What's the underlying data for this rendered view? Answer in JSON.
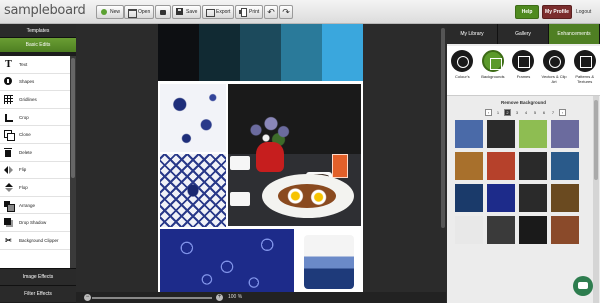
{
  "header": {
    "logo_text": "sampleboard",
    "buttons": [
      {
        "label": "New",
        "icon": "new-icon"
      },
      {
        "label": "Open",
        "icon": "open-icon"
      },
      {
        "label": "",
        "icon": "bag-icon"
      },
      {
        "label": "Save",
        "icon": "save-icon"
      },
      {
        "label": "Export",
        "icon": "export-icon"
      },
      {
        "label": "Print",
        "icon": "print-icon"
      }
    ],
    "undo_glyph": "↶",
    "redo_glyph": "↷",
    "help_label": "Help",
    "profile_label": "My Profile",
    "logout_label": "Logout"
  },
  "sidebar": {
    "templates_label": "Templates",
    "basic_edits_label": "Basic Edits",
    "tools": [
      {
        "label": "Text",
        "icon": "text-icon"
      },
      {
        "label": "Shapes",
        "icon": "shapes-icon"
      },
      {
        "label": "Gridlines",
        "icon": "gridlines-icon"
      },
      {
        "label": "Crop",
        "icon": "crop-icon"
      },
      {
        "label": "Clone",
        "icon": "clone-icon"
      },
      {
        "label": "Delete",
        "icon": "delete-icon"
      },
      {
        "label": "Flip",
        "icon": "flip-icon"
      },
      {
        "label": "Flop",
        "icon": "flop-icon"
      },
      {
        "label": "Arrange",
        "icon": "arrange-icon"
      },
      {
        "label": "Drop Shadow",
        "icon": "drop-shadow-icon"
      },
      {
        "label": "Background Clipper",
        "icon": "scissors-icon"
      }
    ],
    "image_effects_label": "Image Effects",
    "filter_effects_label": "Filter Effects"
  },
  "canvas": {
    "swatch_colors": [
      "#0d0f12",
      "#112a33",
      "#1c4a5c",
      "#2a7a9a",
      "#3aa7dd"
    ],
    "zoom_label": "100 %"
  },
  "right_panel": {
    "tabs": [
      "My Library",
      "Gallery",
      "Enhancements"
    ],
    "active_tab": "Enhancements",
    "categories": [
      {
        "label": "Colour's",
        "icon": "colours-icon"
      },
      {
        "label": "Backgrounds",
        "icon": "backgrounds-icon"
      },
      {
        "label": "Frames",
        "icon": "frames-icon"
      },
      {
        "label": "Vectors & Clip Art",
        "icon": "vectors-icon"
      },
      {
        "label": "Patterns & Textures",
        "icon": "patterns-icon"
      }
    ],
    "remove_background_label": "Remove Background",
    "pager": {
      "pages": [
        "1",
        "2",
        "3",
        "4",
        "5",
        "6",
        "7"
      ],
      "active": "2"
    },
    "thumb_colors": [
      "#4a6aa8",
      "#2a2a2a",
      "#8ebd52",
      "#6b6b9e",
      "#a8702c",
      "#b6412b",
      "#2a2a2a",
      "#2a5a8a",
      "#1a3a6a",
      "#1d2b8a",
      "#2a2a2a",
      "#6a4a20",
      "#e8e8e8",
      "#3a3a3a",
      "#1a1a1a",
      "#8a4a2a"
    ]
  }
}
